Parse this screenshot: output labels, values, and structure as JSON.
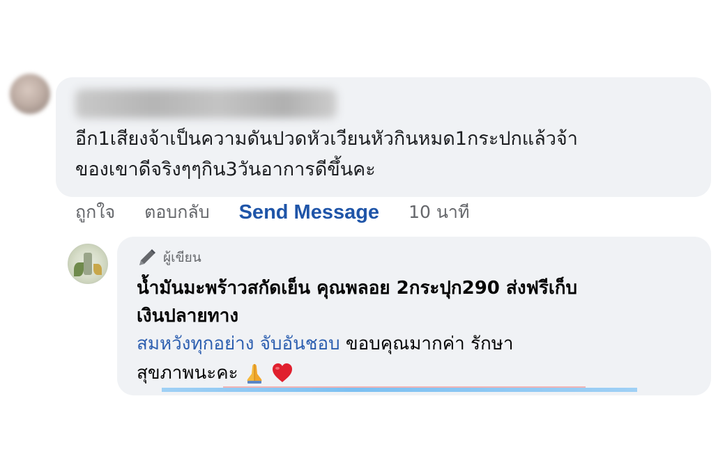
{
  "comment": {
    "text": "อีก1เสียงจ้าเป็นความดันปวดหัวเวียนหัวกินหมด1กระปกแล้วจ้า\nของเขาดีจริงๆๆกิน3วันอาการดีขึ้นคะ"
  },
  "actions": {
    "like": "ถูกใจ",
    "reply": "ตอบกลับ",
    "send_message": "Send Message",
    "time": "10 นาที"
  },
  "reply": {
    "author_badge": "ผู้เขียน",
    "line1": "น้ำมันมะพร้าวสกัดเย็น คุณพลอย 2กระปุก290 ส่งฟรีเก็บ\nเงินปลายทาง",
    "mention": "สมหวังทุกอย่าง จับอันชอบ",
    "line2_rest": " ขอบคุณมากค่า รักษา",
    "line3": "สุขภาพนะคะ",
    "emojis": [
      "folded-hands-icon",
      "red-heart-icon"
    ]
  },
  "colors": {
    "link_blue": "#1f55a8",
    "mention_blue": "#2d5fb0",
    "bubble_gray": "#f0f2f5",
    "meta_gray": "#65676b"
  }
}
